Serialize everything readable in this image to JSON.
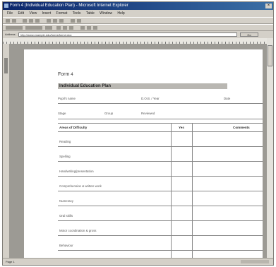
{
  "window": {
    "title": "Form 4 (Individual Education Plan) - Microsoft Internet Explorer",
    "menu": [
      "File",
      "Edit",
      "View",
      "Insert",
      "Format",
      "Tools",
      "Table",
      "Window",
      "Help"
    ],
    "address_label": "Address",
    "address_value": "http://www.example.edu/forms/form4.doc",
    "go_label": "Go",
    "status_text": "Page 1"
  },
  "document": {
    "form_label": "Form",
    "form_number": "4",
    "plan_title": "Individual Education Plan",
    "fields_row1": [
      "Pupil's name",
      "D.O.B. / Year",
      "Date"
    ],
    "fields_row2": [
      "Stage",
      "Group",
      "Reviewed"
    ],
    "table": {
      "headers": [
        "Areas of Difficulty",
        "Yes",
        "Comments"
      ],
      "rows": [
        "Reading",
        "Spelling",
        "Handwriting/presentation",
        "Comprehension & written work",
        "Numeracy",
        "Oral skills",
        "Motor coordination & gross",
        "Behaviour"
      ]
    }
  }
}
